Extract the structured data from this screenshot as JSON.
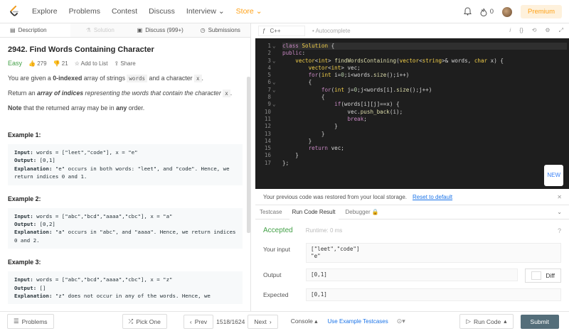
{
  "nav": {
    "items": [
      "Explore",
      "Problems",
      "Contest",
      "Discuss",
      "Interview",
      "Store"
    ],
    "notifications": "0",
    "premium": "Premium"
  },
  "tabs": [
    "Description",
    "Solution",
    "Discuss (999+)",
    "Submissions"
  ],
  "problem": {
    "title": "2942. Find Words Containing Character",
    "difficulty": "Easy",
    "likes": "279",
    "dislikes": "21",
    "add_to_list": "Add to List",
    "share": "Share"
  },
  "desc": {
    "p1_a": "You are given a ",
    "p1_b": "0-indexed",
    "p1_c": " array of strings ",
    "p1_d": "words",
    "p1_e": " and a character ",
    "p1_f": "x",
    "p1_g": ".",
    "p2_a": "Return an ",
    "p2_b": "array of indices",
    "p2_c": " representing the words that contain the character ",
    "p2_d": "x",
    "p2_e": ".",
    "p3_a": "Note",
    "p3_b": " that the returned array may be in ",
    "p3_c": "any",
    "p3_d": " order."
  },
  "examples": [
    {
      "title": "Example 1:",
      "input_label": "Input:",
      "input": " words = [\"leet\",\"code\"], x = \"e\"",
      "output_label": "Output:",
      "output": " [0,1]",
      "expl_label": "Explanation:",
      "expl": " \"e\" occurs in both words: \"leet\", and \"code\". Hence, we return indices 0 and 1."
    },
    {
      "title": "Example 2:",
      "input_label": "Input:",
      "input": " words = [\"abc\",\"bcd\",\"aaaa\",\"cbc\"], x = \"a\"",
      "output_label": "Output:",
      "output": " [0,2]",
      "expl_label": "Explanation:",
      "expl": " \"a\" occurs in \"abc\", and \"aaaa\". Hence, we return indices 0 and 2."
    },
    {
      "title": "Example 3:",
      "input_label": "Input:",
      "input": " words = [\"abc\",\"bcd\",\"aaaa\",\"cbc\"], x = \"z\"",
      "output_label": "Output:",
      "output": " []",
      "expl_label": "Explanation:",
      "expl": " \"z\" does not occur in any of the words. Hence, we"
    }
  ],
  "editor": {
    "language": "C++",
    "autocomplete": "Autocomplete",
    "new_badge": "NEW"
  },
  "restored": {
    "msg": "Your previous code was restored from your local storage.",
    "reset": "Reset to default"
  },
  "result_tabs": [
    "Testcase",
    "Run Code Result",
    "Debugger"
  ],
  "result": {
    "status": "Accepted",
    "runtime": "Runtime: 0 ms",
    "your_input_label": "Your input",
    "your_input": "[\"leet\",\"code\"]\n\"e\"",
    "output_label": "Output",
    "output": "[0,1]",
    "diff": "Diff",
    "expected_label": "Expected",
    "expected": "[0,1]"
  },
  "footer": {
    "problems": "Problems",
    "pick_one": "Pick One",
    "prev": "Prev",
    "counter": "1518/1624",
    "next": "Next",
    "console": "Console",
    "use_example": "Use Example Testcases",
    "run_code": "Run Code",
    "submit": "Submit"
  },
  "colors": {
    "brand": "#ffa116",
    "accepted": "#43a047",
    "link": "#1a73e8",
    "editor_bg": "#1e1e1e",
    "submit_bg": "#546e7a"
  }
}
